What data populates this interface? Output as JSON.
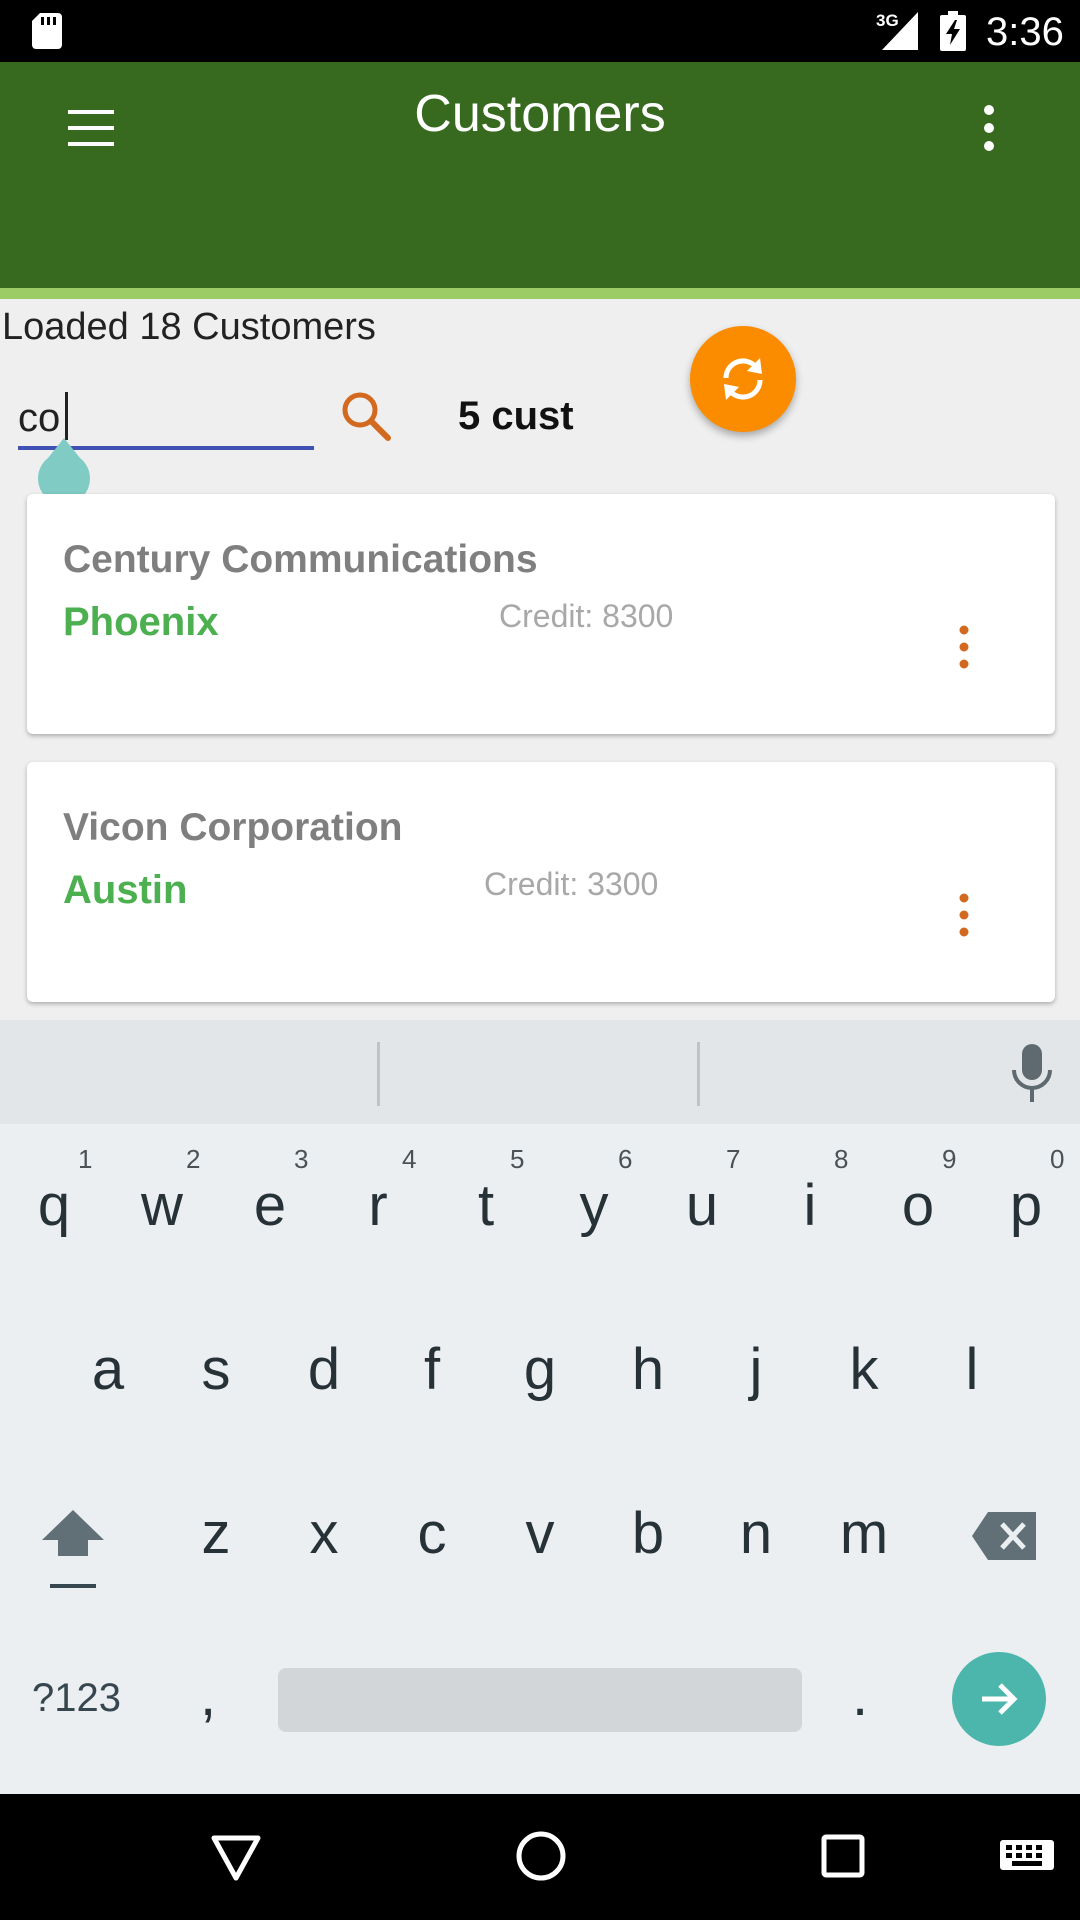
{
  "status_bar": {
    "time": "3:36",
    "network": "3G"
  },
  "app_bar": {
    "title": "Customers",
    "background_color": "#376a1f",
    "accent_color": "#9ccc65"
  },
  "content": {
    "loaded_text": "Loaded 18 Customers",
    "search": {
      "value": "co",
      "placeholder": ""
    },
    "result_count": "5 cust",
    "refresh_color": "#fb8c00"
  },
  "customers": [
    {
      "name": "Century Communications",
      "city": "Phoenix",
      "credit": "Credit: 8300"
    },
    {
      "name": "Vicon Corporation",
      "city": "Austin",
      "credit": "Credit: 3300"
    }
  ],
  "keyboard": {
    "row1": [
      "q",
      "w",
      "e",
      "r",
      "t",
      "y",
      "u",
      "i",
      "o",
      "p"
    ],
    "row1_hints": [
      "1",
      "2",
      "3",
      "4",
      "5",
      "6",
      "7",
      "8",
      "9",
      "0"
    ],
    "row2": [
      "a",
      "s",
      "d",
      "f",
      "g",
      "h",
      "j",
      "k",
      "l"
    ],
    "row3": [
      "z",
      "x",
      "c",
      "v",
      "b",
      "n",
      "m"
    ],
    "symbols_label": "?123",
    "comma": ",",
    "period": "."
  }
}
